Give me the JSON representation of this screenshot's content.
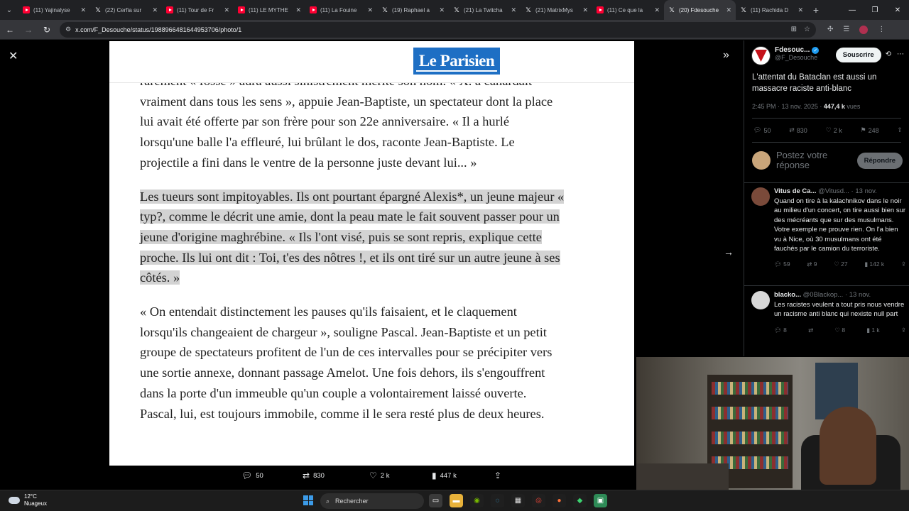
{
  "browser": {
    "tabs": [
      {
        "icon": "youtube",
        "title": "(11) Yajinalyse"
      },
      {
        "icon": "x",
        "title": "(22) Cerfia sur"
      },
      {
        "icon": "youtube",
        "title": "(11) Tour de Fr"
      },
      {
        "icon": "youtube",
        "title": "(11) LE MYTHE"
      },
      {
        "icon": "youtube",
        "title": "(11) La Fouine"
      },
      {
        "icon": "x",
        "title": "(19) Raphael a"
      },
      {
        "icon": "x",
        "title": "(21) La Twitcha"
      },
      {
        "icon": "x",
        "title": "(21) MatrixMys"
      },
      {
        "icon": "youtube",
        "title": "(11) Ce que la"
      },
      {
        "icon": "x",
        "title": "(20) Fdesouche"
      },
      {
        "icon": "x",
        "title": "(11) Rachida D"
      }
    ],
    "active_tab": 9,
    "url": "x.com/F_Desouche/status/1988966481644953706/photo/1"
  },
  "article": {
    "logo": "Le Parisien",
    "paragraphs": [
      {
        "highlighted": false,
        "text": "rarement « fosse » aura aussi sinistrement mérité son nom. « X. a canardait vraiment dans tous les sens », appuie Jean-Baptiste, un spectateur dont la place lui avait été offerte par son frère pour son 22e anniversaire.  « Il a hurlé lorsqu'une balle l'a effleuré, lui brûlant le dos, raconte Jean-Baptiste. Le projectile a fini dans le ventre de la personne juste devant lui... »"
      },
      {
        "highlighted": true,
        "text": "Les tueurs sont impitoyables. Ils ont pourtant épargné Alexis*, un jeune majeur « typ?, comme le décrit une amie, dont la peau mate le fait souvent passer pour un jeune d'origine maghrébine. « Ils l'ont visé, puis se sont repris, explique cette proche. Ils lui ont dit : Toi, t'es des nôtres !, et ils ont tiré sur un autre jeune à ses côtés. »"
      },
      {
        "highlighted": false,
        "text": "« On entendait distinctement les pauses qu'ils faisaient, et le claquement lorsqu'ils changeaient de chargeur », souligne Pascal. Jean-Baptiste et un petit groupe de spectateurs profitent de l'un de ces intervalles pour se précipiter vers une sortie annexe, donnant passage Amelot. Une fois dehors, ils s'engouffrent dans la porte d'un immeuble qu'un couple a volontairement laissé ouverte. Pascal, lui, est toujours immobile, comme il le sera resté plus de deux heures."
      }
    ]
  },
  "viewer_actions": {
    "replies": "50",
    "reposts": "830",
    "likes": "2 k",
    "views": "447 k"
  },
  "tweet": {
    "author_name": "Fdesouc...",
    "author_handle": "@F_Desouche",
    "subscribe_label": "Souscrire",
    "text": "L'attentat du Bataclan est aussi un massacre raciste anti-blanc",
    "time": "2:45 PM · 13 nov. 2025 · ",
    "views_count": "447,4 k",
    "views_label": " vues",
    "stats": {
      "replies": "50",
      "reposts": "830",
      "likes": "2 k",
      "bookmarks": "248"
    },
    "reply_placeholder": "Postez votre réponse",
    "reply_button": "Répondre"
  },
  "replies": [
    {
      "name": "Vitus de Ca...",
      "handle": " @Vitusd... · 13 nov.",
      "text": "Quand on tire à la kalachnikov dans le noir au milieu d'un concert, on tire aussi bien sur des mécréants que sur des musulmans. Votre exemple ne prouve rien. On l'a bien vu à Nice, où 30 musulmans ont été fauchés par le camion du terroriste.",
      "replies": "59",
      "reposts": "9",
      "likes": "27",
      "views": "142 k"
    },
    {
      "name": "blacko...",
      "handle": " @0Blackop... · 13 nov.",
      "text": "Les racistes veulent a tout pris nous vendre un racisme anti blanc qui nexiste null part",
      "replies": "8",
      "reposts": "",
      "likes": "8",
      "views": "1 k"
    }
  ],
  "taskbar": {
    "temperature": "12°C",
    "weather": "Nuageux",
    "search_placeholder": "Rechercher"
  }
}
